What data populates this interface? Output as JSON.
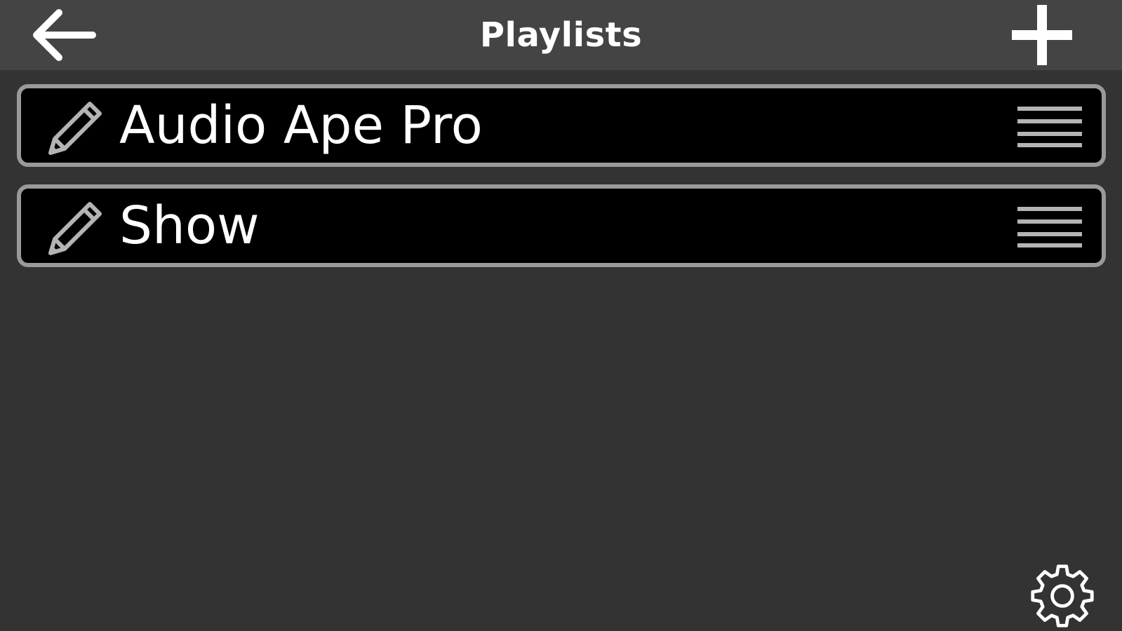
{
  "header": {
    "title": "Playlists",
    "back_icon": "arrow-left-icon",
    "add_icon": "plus-icon",
    "background": "#444444"
  },
  "playlists": [
    {
      "name": "Audio Ape Pro",
      "edit_icon": "pencil-icon",
      "reorder_icon": "drag-handle-icon"
    },
    {
      "name": "Show",
      "edit_icon": "pencil-icon",
      "reorder_icon": "drag-handle-icon"
    }
  ],
  "footer": {
    "settings_icon": "gear-icon"
  },
  "colors": {
    "background": "#333333",
    "item_background": "#000000",
    "item_border": "#9a9a9a",
    "text": "#ffffff",
    "icon_muted": "#b4b4b4"
  }
}
